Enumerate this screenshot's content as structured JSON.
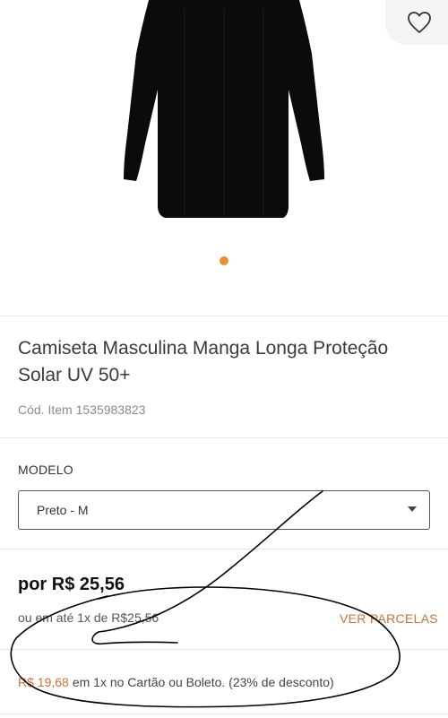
{
  "colors": {
    "accent": "#c8743b",
    "dot": "#e0932f",
    "annotation_ink": "#000000"
  },
  "gallery": {
    "image": "black-long-sleeve-shirt",
    "favorite_icon": "heart-icon",
    "dots": 1
  },
  "product": {
    "title": "Camiseta Masculina Manga Longa Proteção Solar UV 50+",
    "code_label": "Cód. Item",
    "code_value": "1535983823"
  },
  "variant": {
    "label": "MODELO",
    "selected": "Preto - M",
    "caret_icon": "chevron-down-icon"
  },
  "pricing": {
    "price": "por R$ 25,56",
    "installments": "ou em até 1x de R$25,56",
    "installments_link": "VER PARCELAS",
    "discount_price": "R$ 19,68",
    "discount_text": "em 1x no Cartão ou Boleto. (23% de desconto)"
  }
}
